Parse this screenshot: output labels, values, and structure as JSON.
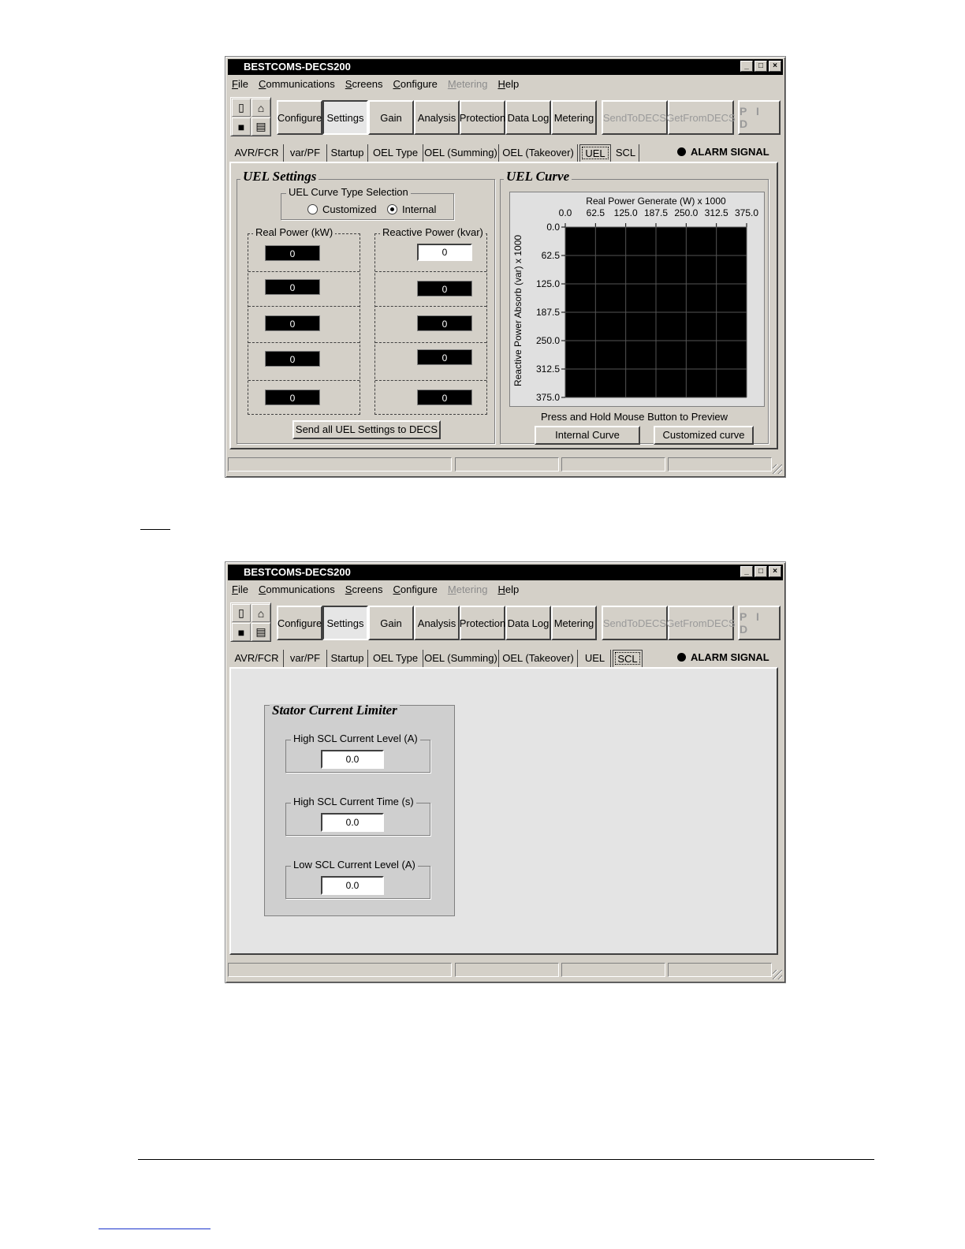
{
  "window": {
    "title": "BESTCOMS-DECS200",
    "menu": [
      "File",
      "Communications",
      "Screens",
      "Configure",
      "Metering",
      "Help"
    ],
    "toolbar": [
      "Configure",
      "Settings",
      "Gain",
      "Analysis",
      "Protection",
      "Data Log",
      "Metering",
      "SendToDECS",
      "GetFromDECS",
      "P I D"
    ],
    "tabs": [
      "AVR/FCR",
      "var/PF",
      "Startup",
      "OEL Type",
      "OEL (Summing)",
      "OEL (Takeover)",
      "UEL",
      "SCL"
    ],
    "alarm": "ALARM SIGNAL"
  },
  "uel": {
    "settings_title": "UEL Settings",
    "curve_type_title": "UEL Curve Type Selection",
    "opt_customized": "Customized",
    "opt_internal": "Internal",
    "real_power_title": "Real Power (kW)",
    "reactive_power_title": "Reactive Power (kvar)",
    "real_values": [
      "0",
      "0",
      "0",
      "0",
      "0"
    ],
    "reactive_values": [
      "0",
      "0",
      "0",
      "0",
      "0"
    ],
    "send_button": "Send all UEL Settings to DECS",
    "curve_title": "UEL Curve",
    "preview_text": "Press and Hold Mouse Button to Preview",
    "internal_curve_button": "Internal Curve",
    "customized_curve_button": "Customized curve"
  },
  "chart_data": {
    "type": "line",
    "title": "",
    "xlabel": "Real Power Generate (W) x 1000",
    "ylabel": "Reactive Power  Absorb (var) x 1000",
    "x_ticks": [
      "0.0",
      "62.5",
      "125.0",
      "187.5",
      "250.0",
      "312.5",
      "375.0"
    ],
    "y_ticks": [
      "0.0",
      "62.5",
      "125.0",
      "187.5",
      "250.0",
      "312.5",
      "375.0"
    ],
    "xlim": [
      0,
      375
    ],
    "ylim": [
      0,
      375
    ],
    "grid": true,
    "background": "#000000",
    "series": []
  },
  "scl": {
    "title": "Stator Current Limiter",
    "high_level_label": "High SCL Current Level (A)",
    "high_level_value": "0.0",
    "high_time_label": "High SCL Current Time (s)",
    "high_time_value": "0.0",
    "low_level_label": "Low SCL Current Level (A)",
    "low_level_value": "0.0"
  }
}
